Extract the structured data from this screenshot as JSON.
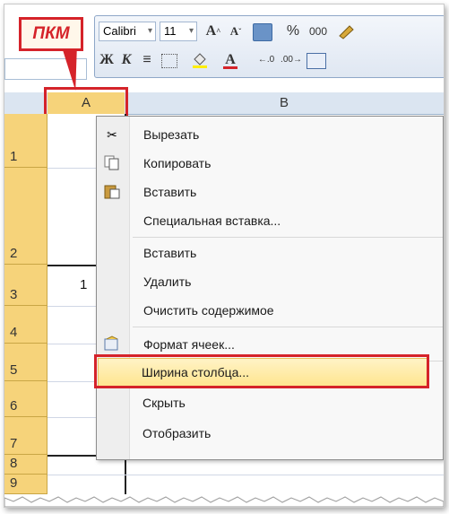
{
  "callout": {
    "label": "ПКМ"
  },
  "toolbar": {
    "font_name": "Calibri",
    "font_size": "11",
    "percent": "%",
    "thousands": "000",
    "bold": "Ж",
    "italic": "К"
  },
  "columns": [
    {
      "label": "A"
    },
    {
      "label": "B"
    }
  ],
  "rows": [
    {
      "label": "1"
    },
    {
      "label": "2"
    },
    {
      "label": "3"
    },
    {
      "label": "4"
    },
    {
      "label": "5"
    },
    {
      "label": "6"
    },
    {
      "label": "7"
    },
    {
      "label": "8"
    },
    {
      "label": "9"
    }
  ],
  "cells": {
    "a3": "1"
  },
  "context_menu": {
    "items": [
      {
        "label": "Вырезать",
        "icon": "scissors-icon"
      },
      {
        "label": "Копировать",
        "icon": "copy-icon"
      },
      {
        "label": "Вставить",
        "icon": "paste-icon"
      },
      {
        "label": "Специальная вставка...",
        "icon": ""
      },
      {
        "label": "Вставить",
        "icon": ""
      },
      {
        "label": "Удалить",
        "icon": ""
      },
      {
        "label": "Очистить содержимое",
        "icon": ""
      },
      {
        "label": "Формат ячеек...",
        "icon": "format-cells-icon"
      },
      {
        "label": "Ширина столбца...",
        "icon": "",
        "highlighted": true
      },
      {
        "label": "Скрыть",
        "icon": ""
      },
      {
        "label": "Отобразить",
        "icon": ""
      }
    ]
  },
  "colors": {
    "accent_red": "#d5232a",
    "row_header_selected": "#f6d37a",
    "menu_highlight": "#ffe58f"
  }
}
